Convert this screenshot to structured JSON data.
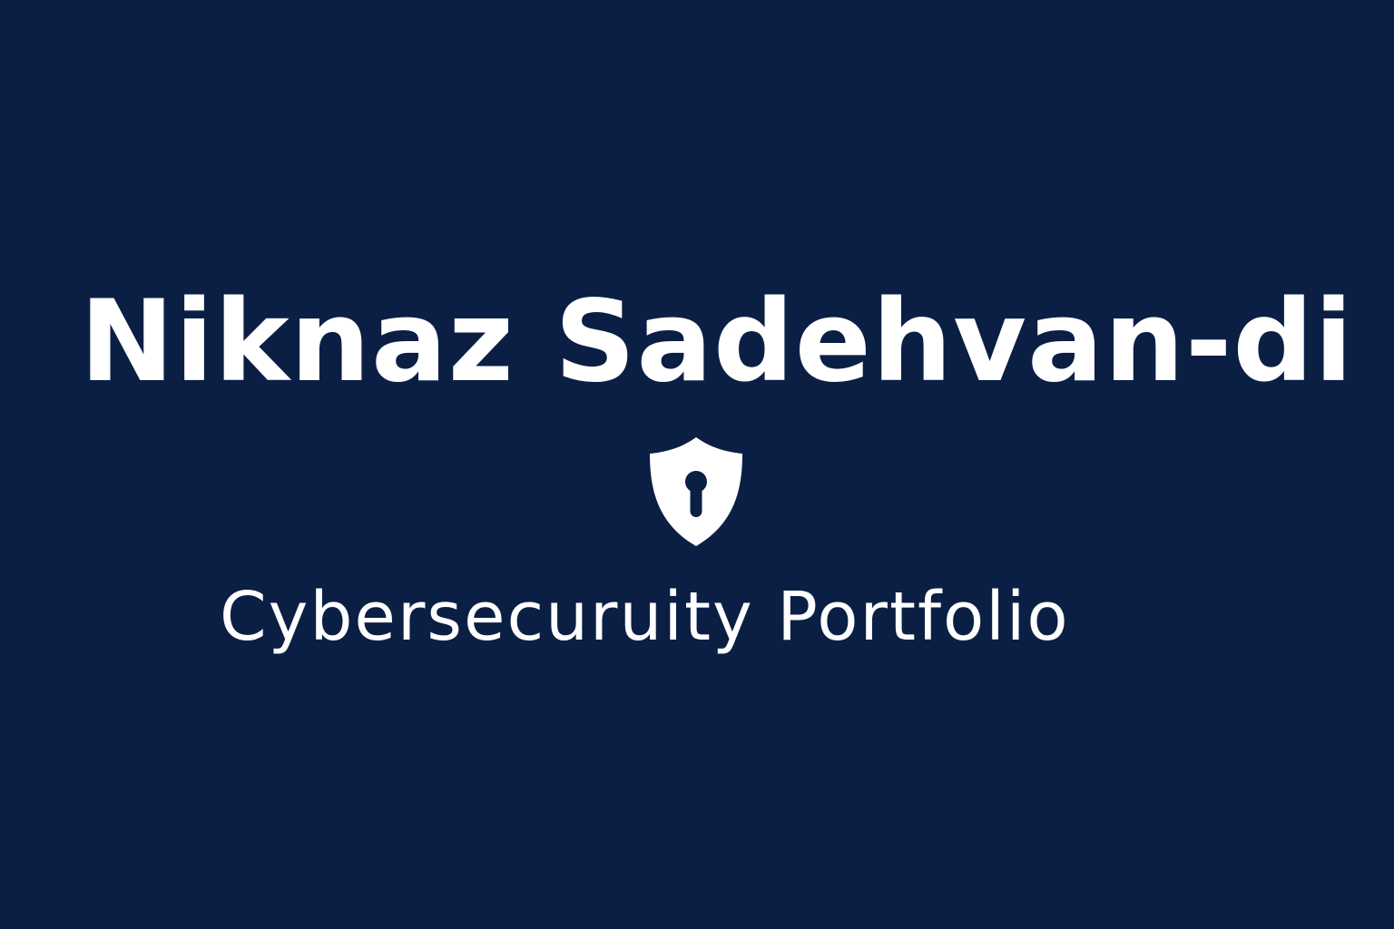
{
  "hero": {
    "name": "Niknaz Sadehvan-di",
    "tagline": "Cybersecuruity Portfolio",
    "emblem_icon": "shield-keyhole-icon"
  },
  "colors": {
    "background": "#0b1f45",
    "text": "#ffffff",
    "emblem": "#ffffff"
  }
}
